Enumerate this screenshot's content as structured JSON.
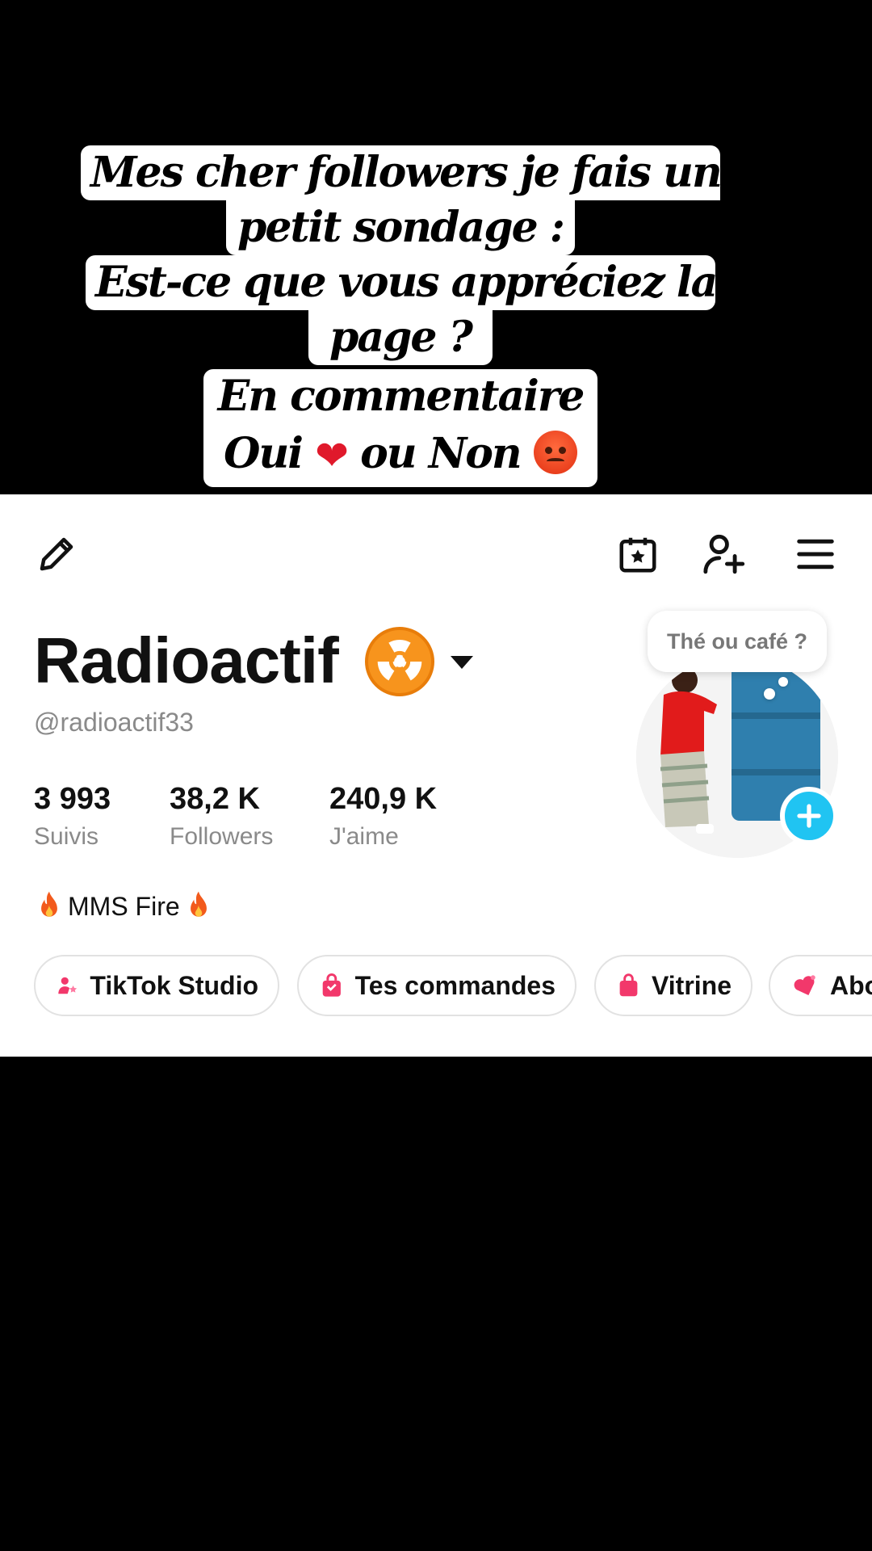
{
  "caption": {
    "line1": "Mes cher followers je fais un",
    "line2": "petit sondage :",
    "line3": "Est-ce que vous appréciez la",
    "line4": "page ?",
    "line5": "En commentaire",
    "line6_oui": "Oui",
    "line6_ou_non": "ou Non"
  },
  "topbar": {
    "icons": [
      "edit-icon",
      "calendar-star-icon",
      "add-user-icon",
      "menu-icon"
    ]
  },
  "profile": {
    "name": "Radioactif",
    "handle": "@radioactif33",
    "note": "Thé ou café ?",
    "stats": [
      {
        "value": "3 993",
        "label": "Suivis"
      },
      {
        "value": "38,2 K",
        "label": "Followers"
      },
      {
        "value": "240,9 K",
        "label": "J'aime"
      }
    ],
    "bio": "MMS Fire"
  },
  "shortcuts": [
    {
      "label": "TikTok Studio",
      "icon": "studio-icon"
    },
    {
      "label": "Tes commandes",
      "icon": "bag-icon"
    },
    {
      "label": "Vitrine",
      "icon": "shop-bag-icon"
    },
    {
      "label": "Abo",
      "icon": "subscription-icon"
    }
  ],
  "colors": {
    "accent_blue": "#20c4f2",
    "pink_icon": "#f2386b",
    "radioactive_orange": "#f7941d"
  }
}
